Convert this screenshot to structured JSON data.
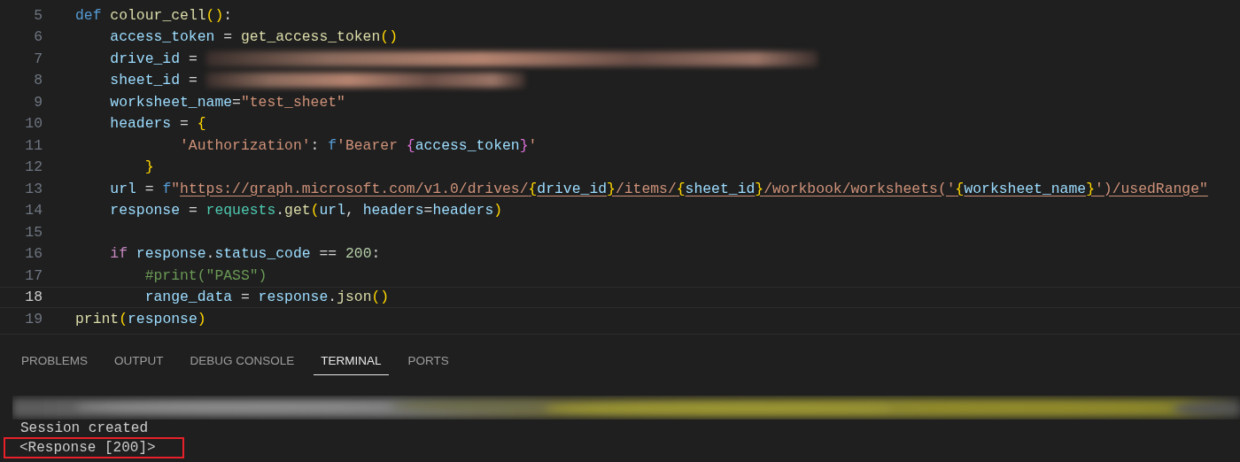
{
  "editor": {
    "lines": [
      {
        "number": "5",
        "selected": false,
        "tokens": [
          {
            "text": "def ",
            "kind": "keyword"
          },
          {
            "text": "colour_cell",
            "kind": "function"
          },
          {
            "text": "()",
            "kind": "bracket"
          },
          {
            "text": ":",
            "kind": "plain"
          }
        ]
      },
      {
        "number": "6",
        "selected": false,
        "tokens": [
          {
            "text": "    access_token",
            "kind": "variable"
          },
          {
            "text": " = ",
            "kind": "plain"
          },
          {
            "text": "get_access_token",
            "kind": "function"
          },
          {
            "text": "()",
            "kind": "bracket"
          }
        ]
      },
      {
        "number": "7",
        "selected": false,
        "tokens": [
          {
            "text": "    drive_id",
            "kind": "variable"
          },
          {
            "text": " = ",
            "kind": "plain"
          },
          {
            "kind": "redacted"
          }
        ]
      },
      {
        "number": "8",
        "selected": false,
        "tokens": [
          {
            "text": "    sheet_id",
            "kind": "variable"
          },
          {
            "text": " = ",
            "kind": "plain"
          },
          {
            "kind": "redacted"
          }
        ]
      },
      {
        "number": "9",
        "selected": false,
        "tokens": [
          {
            "text": "    worksheet_name",
            "kind": "variable"
          },
          {
            "text": "=",
            "kind": "plain"
          },
          {
            "text": "\"test_sheet\"",
            "kind": "string"
          }
        ]
      },
      {
        "number": "10",
        "selected": false,
        "tokens": [
          {
            "text": "    headers",
            "kind": "variable"
          },
          {
            "text": " = ",
            "kind": "plain"
          },
          {
            "text": "{",
            "kind": "bracket"
          }
        ]
      },
      {
        "number": "11",
        "selected": false,
        "tokens": [
          {
            "text": "            'Authorization'",
            "kind": "string"
          },
          {
            "text": ": ",
            "kind": "plain"
          },
          {
            "text": "f",
            "kind": "keyword"
          },
          {
            "text": "'Bearer ",
            "kind": "string"
          },
          {
            "text": "{",
            "kind": "bracket2"
          },
          {
            "text": "access_token",
            "kind": "variable"
          },
          {
            "text": "}",
            "kind": "bracket2"
          },
          {
            "text": "'",
            "kind": "string"
          }
        ]
      },
      {
        "number": "12",
        "selected": false,
        "tokens": [
          {
            "text": "        }",
            "kind": "bracket"
          }
        ]
      },
      {
        "number": "13",
        "selected": false,
        "tokens": [
          {
            "text": "    url",
            "kind": "variable"
          },
          {
            "text": " = ",
            "kind": "plain"
          },
          {
            "text": "f",
            "kind": "keyword"
          },
          {
            "text": "\"",
            "kind": "string"
          },
          {
            "text": "https://graph.microsoft.com/v1.0/drives/",
            "kind": "url"
          },
          {
            "text": "{",
            "kind": "url-brace"
          },
          {
            "text": "drive_id",
            "kind": "url-var"
          },
          {
            "text": "}",
            "kind": "url-brace"
          },
          {
            "text": "/items/",
            "kind": "url"
          },
          {
            "text": "{",
            "kind": "url-brace"
          },
          {
            "text": "sheet_id",
            "kind": "url-var"
          },
          {
            "text": "}",
            "kind": "url-brace"
          },
          {
            "text": "/workbook/worksheets('",
            "kind": "url"
          },
          {
            "text": "{",
            "kind": "url-brace"
          },
          {
            "text": "worksheet_name",
            "kind": "url-var"
          },
          {
            "text": "}",
            "kind": "url-brace"
          },
          {
            "text": "')/usedRange\"",
            "kind": "url"
          }
        ]
      },
      {
        "number": "14",
        "selected": false,
        "tokens": [
          {
            "text": "    response",
            "kind": "variable"
          },
          {
            "text": " = ",
            "kind": "plain"
          },
          {
            "text": "requests",
            "kind": "class"
          },
          {
            "text": ".",
            "kind": "plain"
          },
          {
            "text": "get",
            "kind": "function"
          },
          {
            "text": "(",
            "kind": "bracket"
          },
          {
            "text": "url",
            "kind": "variable"
          },
          {
            "text": ", ",
            "kind": "plain"
          },
          {
            "text": "headers",
            "kind": "variable"
          },
          {
            "text": "=",
            "kind": "plain"
          },
          {
            "text": "headers",
            "kind": "variable"
          },
          {
            "text": ")",
            "kind": "bracket"
          }
        ]
      },
      {
        "number": "15",
        "selected": false
      },
      {
        "number": "16",
        "selected": false,
        "tokens": [
          {
            "text": "    if ",
            "kind": "control"
          },
          {
            "text": "response",
            "kind": "variable"
          },
          {
            "text": ".",
            "kind": "plain"
          },
          {
            "text": "status_code",
            "kind": "variable"
          },
          {
            "text": " == ",
            "kind": "plain"
          },
          {
            "text": "200",
            "kind": "number"
          },
          {
            "text": ":",
            "kind": "plain"
          }
        ]
      },
      {
        "number": "17",
        "selected": false,
        "tokens": [
          {
            "text": "        #print(\"PASS\")",
            "kind": "comment"
          }
        ]
      },
      {
        "number": "18",
        "selected": true,
        "tokens": [
          {
            "text": "        range_data",
            "kind": "variable"
          },
          {
            "text": " = ",
            "kind": "plain"
          },
          {
            "text": "response",
            "kind": "variable"
          },
          {
            "text": ".",
            "kind": "plain"
          },
          {
            "text": "json",
            "kind": "function"
          },
          {
            "text": "()",
            "kind": "bracket"
          }
        ]
      },
      {
        "number": "19",
        "selected": false,
        "tokens": [
          {
            "text": "print",
            "kind": "function"
          },
          {
            "text": "(",
            "kind": "bracket"
          },
          {
            "text": "response",
            "kind": "variable"
          },
          {
            "text": ")",
            "kind": "bracket"
          }
        ]
      }
    ]
  },
  "panel": {
    "tabs": [
      {
        "label": "PROBLEMS",
        "selected": false
      },
      {
        "label": "OUTPUT",
        "selected": false
      },
      {
        "label": "DEBUG CONSOLE",
        "selected": false
      },
      {
        "label": "TERMINAL",
        "selected": true
      },
      {
        "label": "PORTS",
        "selected": false
      }
    ],
    "terminal": {
      "lines": [
        {
          "kind": "redacted"
        },
        {
          "kind": "text",
          "text": "Session created",
          "highlighted": false
        },
        {
          "kind": "text",
          "text": "<Response [200]>",
          "highlighted": true
        }
      ]
    }
  }
}
